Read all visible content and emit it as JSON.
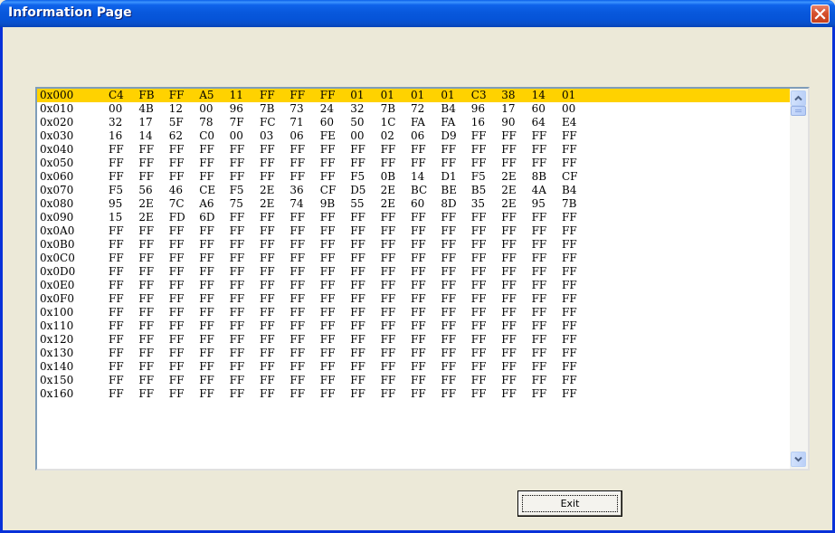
{
  "window": {
    "title": "Information Page"
  },
  "colors": {
    "selected_row": "#FFD200",
    "title_bar": "#0858DC",
    "close_button": "#D5512E"
  },
  "icons": {
    "close": "close-x-icon",
    "scroll_up": "chevron-up-icon",
    "scroll_down": "chevron-down-icon"
  },
  "hex_rows": [
    {
      "addr": "0x000",
      "bytes": [
        "C4",
        "FB",
        "FF",
        "A5",
        "11",
        "FF",
        "FF",
        "FF",
        "01",
        "01",
        "01",
        "01",
        "C3",
        "38",
        "14",
        "01"
      ]
    },
    {
      "addr": "0x010",
      "bytes": [
        "00",
        "4B",
        "12",
        "00",
        "96",
        "7B",
        "73",
        "24",
        "32",
        "7B",
        "72",
        "B4",
        "96",
        "17",
        "60",
        "00"
      ]
    },
    {
      "addr": "0x020",
      "bytes": [
        "32",
        "17",
        "5F",
        "78",
        "7F",
        "FC",
        "71",
        "60",
        "50",
        "1C",
        "FA",
        "FA",
        "16",
        "90",
        "64",
        "E4"
      ]
    },
    {
      "addr": "0x030",
      "bytes": [
        "16",
        "14",
        "62",
        "C0",
        "00",
        "03",
        "06",
        "FE",
        "00",
        "02",
        "06",
        "D9",
        "FF",
        "FF",
        "FF",
        "FF"
      ]
    },
    {
      "addr": "0x040",
      "bytes": [
        "FF",
        "FF",
        "FF",
        "FF",
        "FF",
        "FF",
        "FF",
        "FF",
        "FF",
        "FF",
        "FF",
        "FF",
        "FF",
        "FF",
        "FF",
        "FF"
      ]
    },
    {
      "addr": "0x050",
      "bytes": [
        "FF",
        "FF",
        "FF",
        "FF",
        "FF",
        "FF",
        "FF",
        "FF",
        "FF",
        "FF",
        "FF",
        "FF",
        "FF",
        "FF",
        "FF",
        "FF"
      ]
    },
    {
      "addr": "0x060",
      "bytes": [
        "FF",
        "FF",
        "FF",
        "FF",
        "FF",
        "FF",
        "FF",
        "FF",
        "F5",
        "0B",
        "14",
        "D1",
        "F5",
        "2E",
        "8B",
        "CF"
      ]
    },
    {
      "addr": "0x070",
      "bytes": [
        "F5",
        "56",
        "46",
        "CE",
        "F5",
        "2E",
        "36",
        "CF",
        "D5",
        "2E",
        "BC",
        "BE",
        "B5",
        "2E",
        "4A",
        "B4"
      ]
    },
    {
      "addr": "0x080",
      "bytes": [
        "95",
        "2E",
        "7C",
        "A6",
        "75",
        "2E",
        "74",
        "9B",
        "55",
        "2E",
        "60",
        "8D",
        "35",
        "2E",
        "95",
        "7B"
      ]
    },
    {
      "addr": "0x090",
      "bytes": [
        "15",
        "2E",
        "FD",
        "6D",
        "FF",
        "FF",
        "FF",
        "FF",
        "FF",
        "FF",
        "FF",
        "FF",
        "FF",
        "FF",
        "FF",
        "FF"
      ]
    },
    {
      "addr": "0x0A0",
      "bytes": [
        "FF",
        "FF",
        "FF",
        "FF",
        "FF",
        "FF",
        "FF",
        "FF",
        "FF",
        "FF",
        "FF",
        "FF",
        "FF",
        "FF",
        "FF",
        "FF"
      ]
    },
    {
      "addr": "0x0B0",
      "bytes": [
        "FF",
        "FF",
        "FF",
        "FF",
        "FF",
        "FF",
        "FF",
        "FF",
        "FF",
        "FF",
        "FF",
        "FF",
        "FF",
        "FF",
        "FF",
        "FF"
      ]
    },
    {
      "addr": "0x0C0",
      "bytes": [
        "FF",
        "FF",
        "FF",
        "FF",
        "FF",
        "FF",
        "FF",
        "FF",
        "FF",
        "FF",
        "FF",
        "FF",
        "FF",
        "FF",
        "FF",
        "FF"
      ]
    },
    {
      "addr": "0x0D0",
      "bytes": [
        "FF",
        "FF",
        "FF",
        "FF",
        "FF",
        "FF",
        "FF",
        "FF",
        "FF",
        "FF",
        "FF",
        "FF",
        "FF",
        "FF",
        "FF",
        "FF"
      ]
    },
    {
      "addr": "0x0E0",
      "bytes": [
        "FF",
        "FF",
        "FF",
        "FF",
        "FF",
        "FF",
        "FF",
        "FF",
        "FF",
        "FF",
        "FF",
        "FF",
        "FF",
        "FF",
        "FF",
        "FF"
      ]
    },
    {
      "addr": "0x0F0",
      "bytes": [
        "FF",
        "FF",
        "FF",
        "FF",
        "FF",
        "FF",
        "FF",
        "FF",
        "FF",
        "FF",
        "FF",
        "FF",
        "FF",
        "FF",
        "FF",
        "FF"
      ]
    },
    {
      "addr": "0x100",
      "bytes": [
        "FF",
        "FF",
        "FF",
        "FF",
        "FF",
        "FF",
        "FF",
        "FF",
        "FF",
        "FF",
        "FF",
        "FF",
        "FF",
        "FF",
        "FF",
        "FF"
      ]
    },
    {
      "addr": "0x110",
      "bytes": [
        "FF",
        "FF",
        "FF",
        "FF",
        "FF",
        "FF",
        "FF",
        "FF",
        "FF",
        "FF",
        "FF",
        "FF",
        "FF",
        "FF",
        "FF",
        "FF"
      ]
    },
    {
      "addr": "0x120",
      "bytes": [
        "FF",
        "FF",
        "FF",
        "FF",
        "FF",
        "FF",
        "FF",
        "FF",
        "FF",
        "FF",
        "FF",
        "FF",
        "FF",
        "FF",
        "FF",
        "FF"
      ]
    },
    {
      "addr": "0x130",
      "bytes": [
        "FF",
        "FF",
        "FF",
        "FF",
        "FF",
        "FF",
        "FF",
        "FF",
        "FF",
        "FF",
        "FF",
        "FF",
        "FF",
        "FF",
        "FF",
        "FF"
      ]
    },
    {
      "addr": "0x140",
      "bytes": [
        "FF",
        "FF",
        "FF",
        "FF",
        "FF",
        "FF",
        "FF",
        "FF",
        "FF",
        "FF",
        "FF",
        "FF",
        "FF",
        "FF",
        "FF",
        "FF"
      ]
    },
    {
      "addr": "0x150",
      "bytes": [
        "FF",
        "FF",
        "FF",
        "FF",
        "FF",
        "FF",
        "FF",
        "FF",
        "FF",
        "FF",
        "FF",
        "FF",
        "FF",
        "FF",
        "FF",
        "FF"
      ]
    },
    {
      "addr": "0x160",
      "bytes": [
        "FF",
        "FF",
        "FF",
        "FF",
        "FF",
        "FF",
        "FF",
        "FF",
        "FF",
        "FF",
        "FF",
        "FF",
        "FF",
        "FF",
        "FF",
        "FF"
      ]
    }
  ],
  "buttons": {
    "exit": "Exit"
  }
}
